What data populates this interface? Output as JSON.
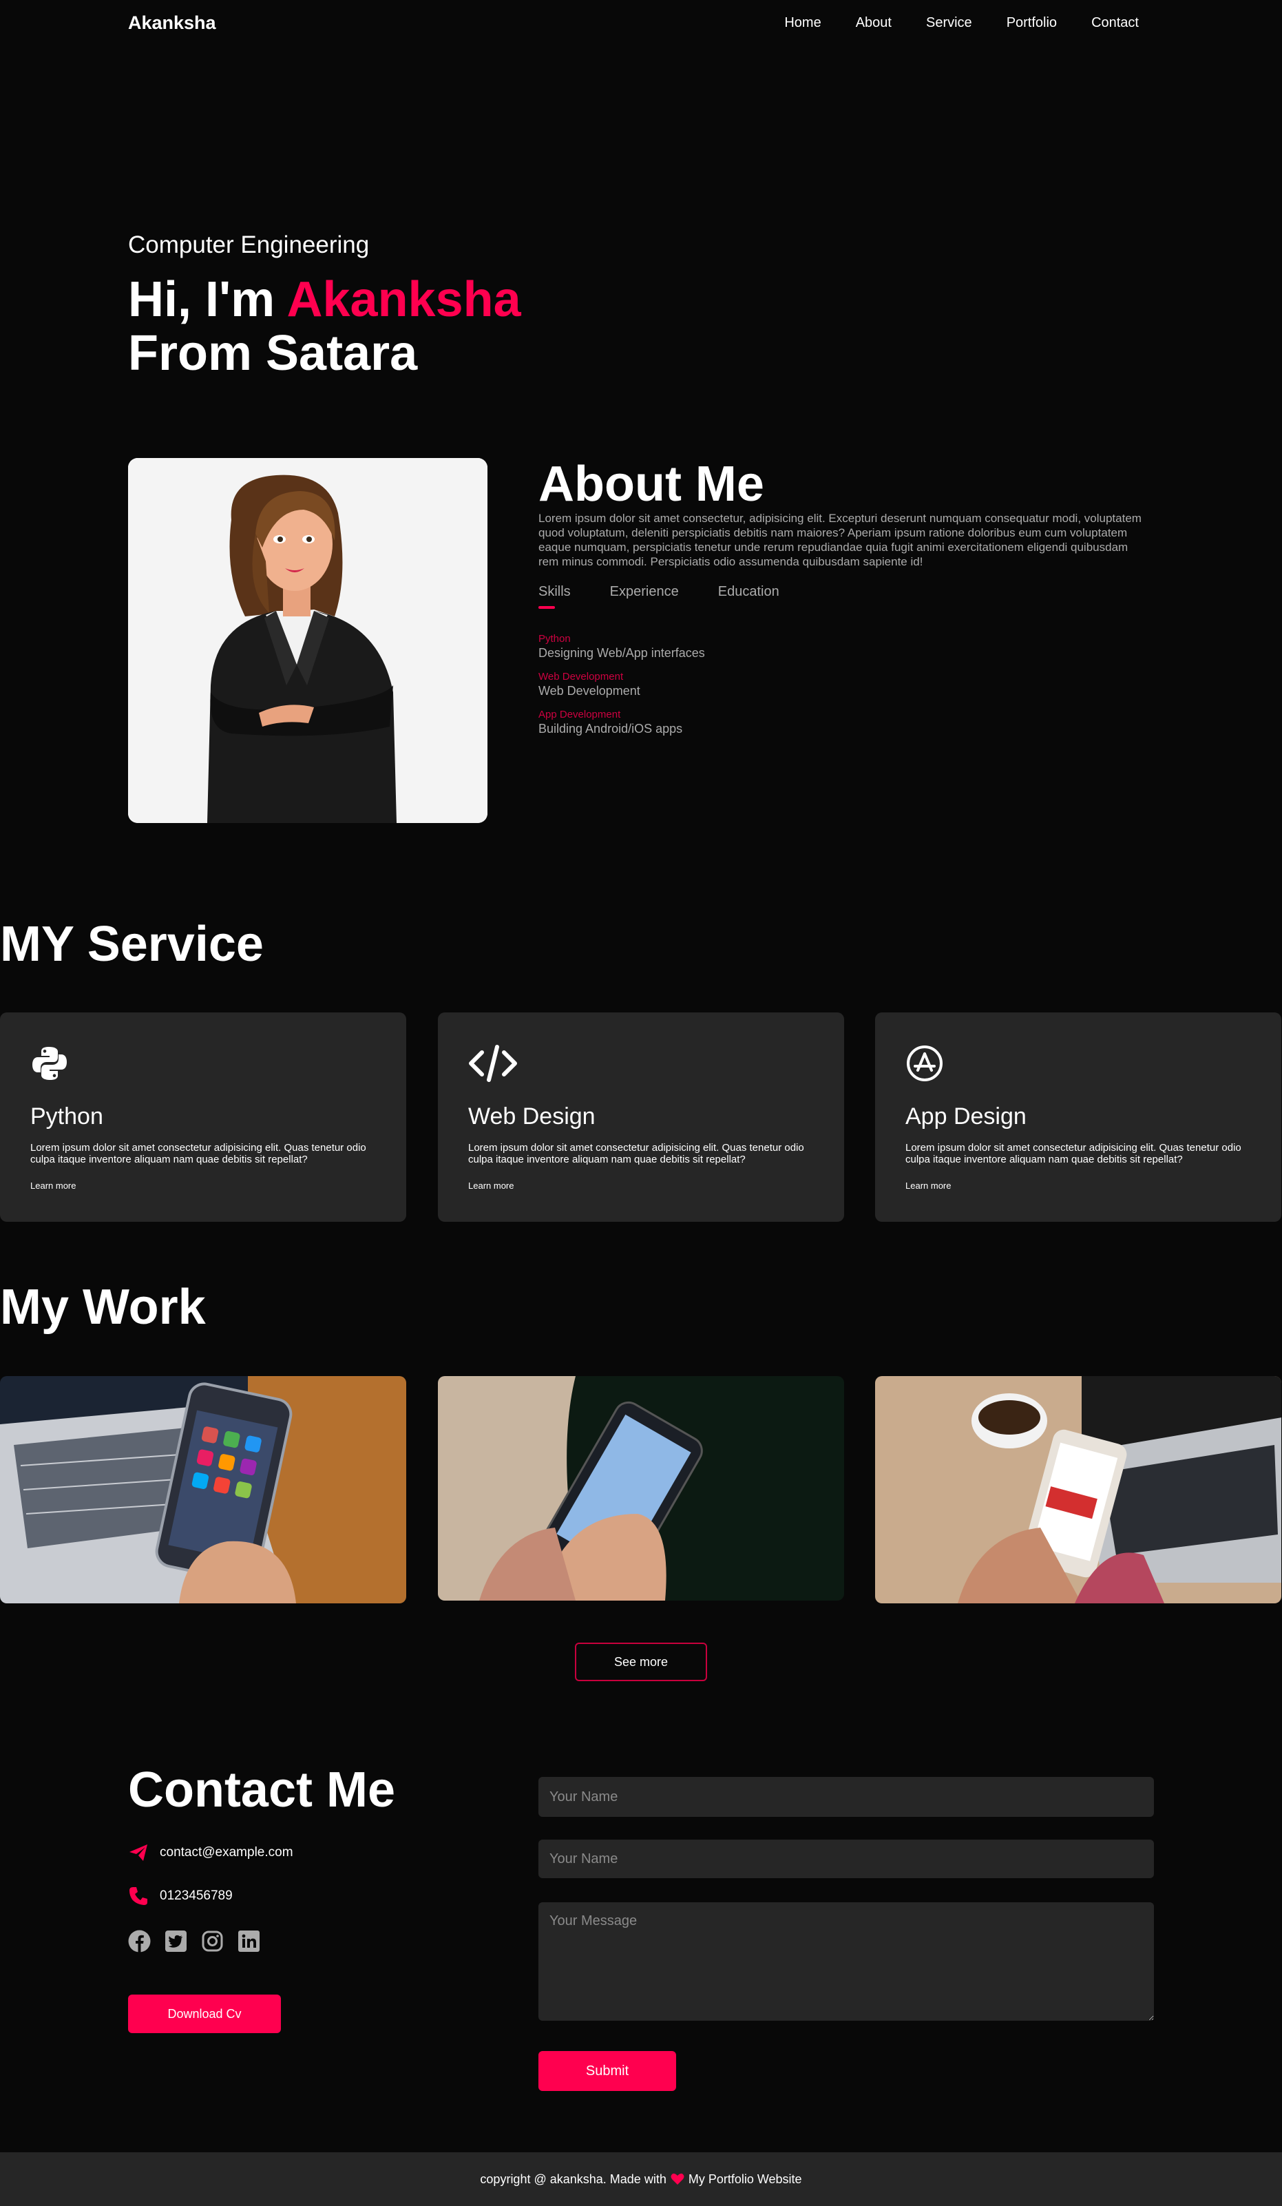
{
  "nav": {
    "logo": "Akanksha",
    "items": [
      "Home",
      "About",
      "Service",
      "Portfolio",
      "Contact"
    ]
  },
  "hero": {
    "subtitle": "Computer Engineering",
    "greeting": "Hi, I'm ",
    "name": "Akanksha",
    "location": "From Satara"
  },
  "about": {
    "title": "About Me",
    "text": "Lorem ipsum dolor sit amet consectetur, adipisicing elit. Excepturi deserunt numquam consequatur modi, voluptatem quod voluptatum, deleniti perspiciatis debitis nam maiores? Aperiam ipsum ratione doloribus eum cum voluptatem eaque numquam, perspiciatis tenetur unde rerum repudiandae quia fugit animi exercitationem eligendi quibusdam rem minus commodi. Perspiciatis odio assumenda quibusdam sapiente id!",
    "tabs": [
      "Skills",
      "Experience",
      "Education"
    ],
    "skills": [
      {
        "name": "Python",
        "desc": "Designing Web/App interfaces"
      },
      {
        "name": "Web Development",
        "desc": "Web Development"
      },
      {
        "name": "App Development",
        "desc": "Building Android/iOS apps"
      }
    ]
  },
  "services": {
    "title": "MY Service",
    "cards": [
      {
        "title": "Python",
        "text": "Lorem ipsum dolor sit amet consectetur adipisicing elit. Quas tenetur odio culpa itaque inventore aliquam nam quae debitis sit repellat?",
        "link": "Learn more",
        "icon": "python-icon"
      },
      {
        "title": "Web Design",
        "text": "Lorem ipsum dolor sit amet consectetur adipisicing elit. Quas tenetur odio culpa itaque inventore aliquam nam quae debitis sit repellat?",
        "link": "Learn more",
        "icon": "code-icon"
      },
      {
        "title": "App Design",
        "text": "Lorem ipsum dolor sit amet consectetur adipisicing elit. Quas tenetur odio culpa itaque inventore aliquam nam quae debitis sit repellat?",
        "link": "Learn more",
        "icon": "app-store-icon"
      }
    ]
  },
  "work": {
    "title": "My Work",
    "see_more": "See more"
  },
  "contact": {
    "title": "Contact Me",
    "email": "contact@example.com",
    "phone": "0123456789",
    "download_cv": "Download Cv",
    "name_placeholder": "Your Name",
    "name2_placeholder": "Your Name",
    "message_placeholder": "Your Message",
    "submit": "Submit",
    "socials": [
      "facebook-icon",
      "twitter-icon",
      "instagram-icon",
      "linkedin-icon"
    ]
  },
  "footer": {
    "text_before": "copyright @ akanksha. Made with",
    "text_after": "My Portfolio Website"
  },
  "colors": {
    "accent": "#ff004f",
    "background": "#080808",
    "card": "#262626"
  }
}
